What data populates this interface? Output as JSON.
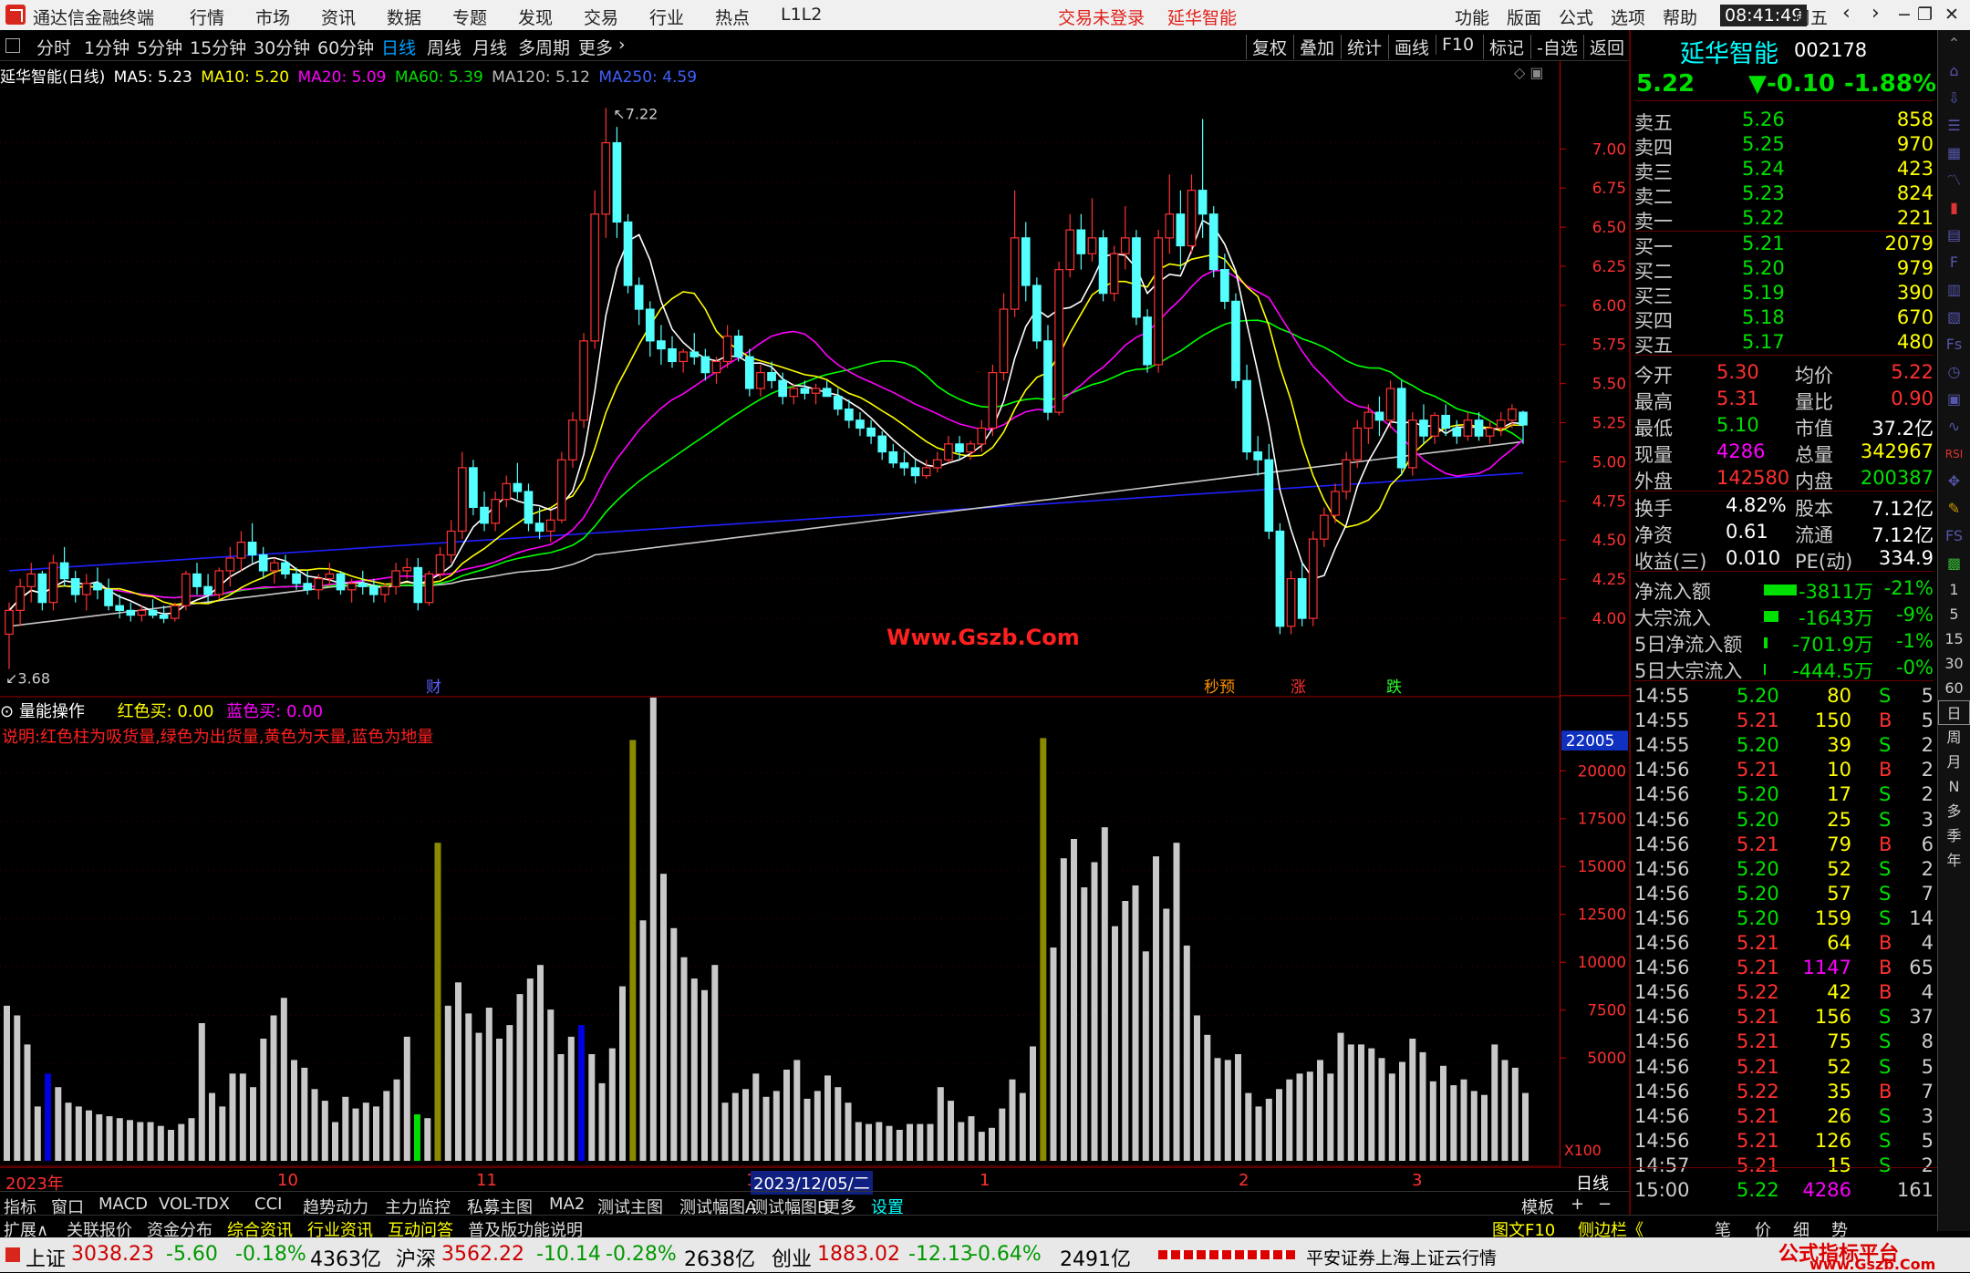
{
  "title_bar": {
    "app": "通达信金融终端",
    "menu": [
      "行情",
      "市场",
      "资讯",
      "数据",
      "专题",
      "发现",
      "交易",
      "行业",
      "热点",
      "L1L2"
    ],
    "login": "交易未登录",
    "stock": "延华智能",
    "right_menu": [
      "功能",
      "版面",
      "公式",
      "选项",
      "帮助"
    ],
    "time": "08:41:49",
    "weekday": "周五"
  },
  "toolbar": {
    "periods": [
      "分时",
      "1分钟",
      "5分钟",
      "15分钟",
      "30分钟",
      "60分钟",
      "日线",
      "周线",
      "月线",
      "多周期",
      "更多"
    ],
    "active": "日线",
    "right": [
      "复权",
      "叠加",
      "统计",
      "画线",
      "F10",
      "标记",
      "-自选",
      "返回"
    ]
  },
  "main_legend": {
    "name": "延华智能(日线)",
    "ma5": "MA5: 5.23",
    "ma10": "MA10: 5.20",
    "ma20": "MA20: 5.09",
    "ma60": "MA60: 5.39",
    "ma120": "MA120: 5.12",
    "ma250": "MA250: 4.59"
  },
  "annotations": {
    "high": "7.22",
    "low": "3.68",
    "watermark": "Www.Gszb.Com",
    "markers": [
      "财",
      "秒预",
      "涨",
      "跌"
    ]
  },
  "price_axis": [
    "7.00",
    "6.75",
    "6.50",
    "6.25",
    "6.00",
    "5.75",
    "5.50",
    "5.25",
    "5.00",
    "4.75",
    "4.50",
    "4.25",
    "4.00"
  ],
  "vol_legend": {
    "name": "量能操作",
    "red_buy": "红色买: 0.00",
    "blue_buy": "蓝色买: 0.00",
    "desc": "说明:红色柱为吸货量,绿色为出货量,黄色为天量,蓝色为地量"
  },
  "vol_axis": {
    "badge": "22005",
    "ticks": [
      "20000",
      "17500",
      "15000",
      "12500",
      "10000",
      "7500",
      "5000"
    ],
    "unit": "X100"
  },
  "date_axis": {
    "labels": [
      "2023年",
      "10",
      "11",
      "12",
      "1",
      "2",
      "3"
    ],
    "cursor": "2023/12/05/二",
    "period": "日线"
  },
  "quote": {
    "name": "延华智能",
    "code": "002178",
    "price": "5.22",
    "change": "▼-0.10",
    "pct": "-1.88%",
    "asks": [
      [
        "卖五",
        "5.26",
        "858"
      ],
      [
        "卖四",
        "5.25",
        "970"
      ],
      [
        "卖三",
        "5.24",
        "423"
      ],
      [
        "卖二",
        "5.23",
        "824"
      ],
      [
        "卖一",
        "5.22",
        "221"
      ]
    ],
    "bids": [
      [
        "买一",
        "5.21",
        "2079"
      ],
      [
        "买二",
        "5.20",
        "979"
      ],
      [
        "买三",
        "5.19",
        "390"
      ],
      [
        "买四",
        "5.18",
        "670"
      ],
      [
        "买五",
        "5.17",
        "480"
      ]
    ],
    "stats": [
      [
        "今开",
        "5.30",
        "均价",
        "5.22"
      ],
      [
        "最高",
        "5.31",
        "量比",
        "0.90"
      ],
      [
        "最低",
        "5.10",
        "市值",
        "37.2亿"
      ],
      [
        "现量",
        "4286",
        "总量",
        "342967"
      ],
      [
        "外盘",
        "142580",
        "内盘",
        "200387"
      ]
    ],
    "stats2": [
      [
        "换手",
        "4.82%",
        "股本",
        "7.12亿"
      ],
      [
        "净资",
        "0.61",
        "流通",
        "7.12亿"
      ],
      [
        "收益(三)",
        "0.010",
        "PE(动)",
        "334.9"
      ]
    ],
    "flows": [
      [
        "净流入额",
        "-3811万",
        "-21%"
      ],
      [
        "大宗流入",
        "-1643万",
        "-9%"
      ],
      [
        "5日净流入额",
        "-701.9万",
        "-1%"
      ],
      [
        "5日大宗流入",
        "-444.5万",
        "-0%"
      ]
    ],
    "ticks": [
      [
        "14:55",
        "5.20",
        "80",
        "S",
        "5"
      ],
      [
        "14:55",
        "5.21",
        "150",
        "B",
        "5"
      ],
      [
        "14:55",
        "5.20",
        "39",
        "S",
        "2"
      ],
      [
        "14:56",
        "5.21",
        "10",
        "B",
        "2"
      ],
      [
        "14:56",
        "5.20",
        "17",
        "S",
        "2"
      ],
      [
        "14:56",
        "5.20",
        "25",
        "S",
        "3"
      ],
      [
        "14:56",
        "5.21",
        "79",
        "B",
        "6"
      ],
      [
        "14:56",
        "5.20",
        "52",
        "S",
        "2"
      ],
      [
        "14:56",
        "5.20",
        "57",
        "S",
        "7"
      ],
      [
        "14:56",
        "5.20",
        "159",
        "S",
        "14"
      ],
      [
        "14:56",
        "5.21",
        "64",
        "B",
        "4"
      ],
      [
        "14:56",
        "5.21",
        "1147",
        "B",
        "65"
      ],
      [
        "14:56",
        "5.22",
        "42",
        "B",
        "4"
      ],
      [
        "14:56",
        "5.21",
        "156",
        "S",
        "37"
      ],
      [
        "14:56",
        "5.21",
        "75",
        "S",
        "8"
      ],
      [
        "14:56",
        "5.21",
        "52",
        "S",
        "5"
      ],
      [
        "14:56",
        "5.22",
        "35",
        "B",
        "7"
      ],
      [
        "14:56",
        "5.21",
        "26",
        "S",
        "3"
      ],
      [
        "14:56",
        "5.21",
        "126",
        "S",
        "5"
      ],
      [
        "14:57",
        "5.21",
        "15",
        "S",
        "2"
      ],
      [
        "15:00",
        "5.22",
        "4286",
        "",
        "161"
      ]
    ]
  },
  "sidebar": [
    "1",
    "5",
    "15",
    "30",
    "60",
    "日",
    "周",
    "月",
    "N",
    "多",
    "季",
    "年"
  ],
  "tabs1": [
    "指标",
    "窗口",
    "MACD",
    "VOL-TDX",
    "CCI",
    "趋势动力",
    "主力监控",
    "私募主图",
    "MA2",
    "测试主图",
    "测试幅图A",
    "测试幅图B",
    "更多",
    "设置"
  ],
  "tabs1_right": [
    "模板",
    "+",
    "−"
  ],
  "tabs2": [
    "扩展∧",
    "关联报价",
    "资金分布",
    "综合资讯",
    "行业资讯",
    "互动问答",
    "普及版功能说明"
  ],
  "tabs2_right": [
    "图文F10",
    "侧边栏《",
    "笔",
    "价",
    "细",
    "势"
  ],
  "status": {
    "sh": [
      "上证",
      "3038.23",
      "-5.60",
      "-0.18%",
      "4363亿"
    ],
    "sz": [
      "沪深",
      "3562.22",
      "-10.14",
      "-0.28%",
      "2638亿"
    ],
    "cy": [
      "创业",
      "1883.02",
      "-12.13",
      "-0.64%",
      "2491亿"
    ],
    "broker": "平安证券上海上证云行情",
    "brand": "公式指标平台",
    "brand_url": "www.Gszb.Com"
  },
  "chart_data": {
    "type": "candlestick",
    "candles": [
      [
        3.9,
        4.1,
        3.68,
        4.05
      ],
      [
        4.05,
        4.25,
        3.95,
        4.2
      ],
      [
        4.2,
        4.35,
        4.1,
        4.28
      ],
      [
        4.28,
        4.3,
        4.05,
        4.1
      ],
      [
        4.1,
        4.4,
        4.05,
        4.35
      ],
      [
        4.35,
        4.45,
        4.2,
        4.25
      ],
      [
        4.25,
        4.3,
        4.1,
        4.15
      ],
      [
        4.15,
        4.28,
        4.05,
        4.22
      ],
      [
        4.22,
        4.32,
        4.12,
        4.18
      ],
      [
        4.18,
        4.25,
        4.05,
        4.08
      ],
      [
        4.08,
        4.15,
        4.0,
        4.05
      ],
      [
        4.05,
        4.1,
        3.98,
        4.02
      ],
      [
        4.02,
        4.08,
        3.98,
        4.05
      ],
      [
        4.05,
        4.12,
        4.0,
        4.02
      ],
      [
        4.02,
        4.08,
        3.97,
        4.0
      ],
      [
        4.0,
        4.1,
        3.98,
        4.08
      ],
      [
        4.08,
        4.3,
        4.05,
        4.28
      ],
      [
        4.28,
        4.35,
        4.15,
        4.2
      ],
      [
        4.2,
        4.28,
        4.1,
        4.15
      ],
      [
        4.15,
        4.32,
        4.12,
        4.3
      ],
      [
        4.3,
        4.45,
        4.2,
        4.38
      ],
      [
        4.38,
        4.55,
        4.3,
        4.48
      ],
      [
        4.48,
        4.6,
        4.35,
        4.4
      ],
      [
        4.4,
        4.45,
        4.25,
        4.3
      ],
      [
        4.3,
        4.38,
        4.22,
        4.35
      ],
      [
        4.35,
        4.4,
        4.25,
        4.28
      ],
      [
        4.28,
        4.32,
        4.18,
        4.22
      ],
      [
        4.22,
        4.3,
        4.15,
        4.18
      ],
      [
        4.18,
        4.28,
        4.12,
        4.25
      ],
      [
        4.25,
        4.35,
        4.2,
        4.28
      ],
      [
        4.28,
        4.3,
        4.15,
        4.18
      ],
      [
        4.18,
        4.25,
        4.1,
        4.22
      ],
      [
        4.22,
        4.3,
        4.15,
        4.2
      ],
      [
        4.2,
        4.25,
        4.1,
        4.15
      ],
      [
        4.15,
        4.22,
        4.1,
        4.2
      ],
      [
        4.2,
        4.35,
        4.15,
        4.3
      ],
      [
        4.3,
        4.38,
        4.25,
        4.32
      ],
      [
        4.32,
        4.38,
        4.05,
        4.1
      ],
      [
        4.1,
        4.3,
        4.08,
        4.28
      ],
      [
        4.28,
        4.45,
        4.25,
        4.4
      ],
      [
        4.4,
        4.62,
        4.35,
        4.55
      ],
      [
        4.55,
        5.05,
        4.5,
        4.95
      ],
      [
        4.95,
        5.0,
        4.65,
        4.7
      ],
      [
        4.7,
        4.8,
        4.55,
        4.6
      ],
      [
        4.6,
        4.8,
        4.55,
        4.75
      ],
      [
        4.75,
        4.9,
        4.7,
        4.85
      ],
      [
        4.85,
        4.98,
        4.75,
        4.8
      ],
      [
        4.8,
        4.85,
        4.55,
        4.6
      ],
      [
        4.6,
        4.7,
        4.5,
        4.55
      ],
      [
        4.55,
        4.68,
        4.48,
        4.62
      ],
      [
        4.62,
        5.05,
        4.6,
        5.0
      ],
      [
        5.0,
        5.3,
        4.95,
        5.25
      ],
      [
        5.25,
        5.8,
        5.2,
        5.75
      ],
      [
        5.75,
        6.7,
        5.7,
        6.55
      ],
      [
        6.55,
        7.22,
        6.4,
        7.0
      ],
      [
        7.0,
        7.1,
        6.4,
        6.5
      ],
      [
        6.5,
        6.55,
        6.05,
        6.1
      ],
      [
        6.1,
        6.15,
        5.85,
        5.95
      ],
      [
        5.95,
        6.0,
        5.65,
        5.75
      ],
      [
        5.75,
        5.85,
        5.6,
        5.7
      ],
      [
        5.7,
        5.78,
        5.58,
        5.62
      ],
      [
        5.62,
        5.7,
        5.55,
        5.68
      ],
      [
        5.68,
        5.8,
        5.6,
        5.65
      ],
      [
        5.65,
        5.7,
        5.5,
        5.55
      ],
      [
        5.55,
        5.65,
        5.48,
        5.62
      ],
      [
        5.62,
        5.85,
        5.58,
        5.78
      ],
      [
        5.78,
        5.82,
        5.62,
        5.65
      ],
      [
        5.65,
        5.7,
        5.4,
        5.45
      ],
      [
        5.45,
        5.6,
        5.4,
        5.55
      ],
      [
        5.55,
        5.62,
        5.45,
        5.5
      ],
      [
        5.5,
        5.55,
        5.35,
        5.4
      ],
      [
        5.4,
        5.48,
        5.35,
        5.45
      ],
      [
        5.45,
        5.5,
        5.38,
        5.42
      ],
      [
        5.42,
        5.48,
        5.35,
        5.45
      ],
      [
        5.45,
        5.5,
        5.4,
        5.4
      ],
      [
        5.4,
        5.45,
        5.28,
        5.32
      ],
      [
        5.32,
        5.38,
        5.2,
        5.25
      ],
      [
        5.25,
        5.3,
        5.15,
        5.2
      ],
      [
        5.2,
        5.25,
        5.1,
        5.15
      ],
      [
        5.15,
        5.18,
        5.0,
        5.05
      ],
      [
        5.05,
        5.1,
        4.95,
        4.98
      ],
      [
        4.98,
        5.05,
        4.9,
        4.95
      ],
      [
        4.95,
        5.0,
        4.85,
        4.9
      ],
      [
        4.9,
        5.0,
        4.88,
        4.95
      ],
      [
        4.95,
        5.05,
        4.92,
        5.0
      ],
      [
        5.0,
        5.15,
        4.98,
        5.1
      ],
      [
        5.1,
        5.15,
        5.0,
        5.05
      ],
      [
        5.05,
        5.12,
        5.0,
        5.1
      ],
      [
        5.1,
        5.25,
        5.05,
        5.2
      ],
      [
        5.2,
        5.6,
        5.15,
        5.55
      ],
      [
        5.55,
        6.05,
        5.5,
        5.95
      ],
      [
        5.95,
        6.7,
        5.9,
        6.4
      ],
      [
        6.4,
        6.5,
        6.0,
        6.1
      ],
      [
        6.1,
        6.15,
        5.7,
        5.75
      ],
      [
        5.75,
        5.85,
        5.25,
        5.3
      ],
      [
        5.3,
        6.25,
        5.28,
        6.2
      ],
      [
        6.2,
        6.55,
        6.15,
        6.45
      ],
      [
        6.45,
        6.55,
        6.2,
        6.3
      ],
      [
        6.3,
        6.65,
        6.25,
        6.4
      ],
      [
        6.4,
        6.45,
        6.0,
        6.05
      ],
      [
        6.05,
        6.35,
        6.0,
        6.3
      ],
      [
        6.3,
        6.6,
        6.2,
        6.4
      ],
      [
        6.4,
        6.45,
        5.85,
        5.9
      ],
      [
        5.9,
        5.95,
        5.55,
        5.6
      ],
      [
        5.6,
        6.45,
        5.55,
        6.4
      ],
      [
        6.4,
        6.8,
        6.3,
        6.55
      ],
      [
        6.55,
        6.7,
        6.2,
        6.35
      ],
      [
        6.35,
        6.8,
        6.3,
        6.7
      ],
      [
        6.7,
        7.15,
        6.4,
        6.55
      ],
      [
        6.55,
        6.6,
        6.15,
        6.2
      ],
      [
        6.2,
        6.3,
        5.95,
        6.0
      ],
      [
        6.0,
        6.05,
        5.45,
        5.5
      ],
      [
        5.5,
        5.6,
        5.0,
        5.05
      ],
      [
        5.05,
        5.15,
        4.9,
        5.0
      ],
      [
        5.0,
        5.1,
        4.5,
        4.55
      ],
      [
        4.55,
        4.6,
        3.9,
        3.95
      ],
      [
        3.95,
        4.3,
        3.9,
        4.25
      ],
      [
        4.25,
        4.35,
        3.95,
        4.0
      ],
      [
        4.0,
        4.55,
        3.95,
        4.5
      ],
      [
        4.5,
        4.7,
        4.45,
        4.65
      ],
      [
        4.65,
        4.85,
        4.6,
        4.8
      ],
      [
        4.8,
        5.05,
        4.75,
        5.0
      ],
      [
        5.0,
        5.25,
        4.95,
        5.2
      ],
      [
        5.2,
        5.35,
        5.1,
        5.3
      ],
      [
        5.3,
        5.4,
        5.15,
        5.25
      ],
      [
        5.25,
        5.5,
        5.2,
        5.45
      ],
      [
        5.45,
        5.5,
        4.9,
        4.95
      ],
      [
        4.95,
        5.3,
        4.9,
        5.25
      ],
      [
        5.25,
        5.35,
        5.1,
        5.15
      ],
      [
        5.15,
        5.3,
        5.1,
        5.28
      ],
      [
        5.28,
        5.35,
        5.15,
        5.2
      ],
      [
        5.2,
        5.25,
        5.1,
        5.15
      ],
      [
        5.15,
        5.3,
        5.12,
        5.25
      ],
      [
        5.25,
        5.3,
        5.12,
        5.15
      ],
      [
        5.15,
        5.25,
        5.1,
        5.2
      ],
      [
        5.2,
        5.3,
        5.15,
        5.25
      ],
      [
        5.25,
        5.35,
        5.2,
        5.32
      ],
      [
        5.3,
        5.31,
        5.1,
        5.22
      ]
    ],
    "volume": [
      8000,
      7500,
      6000,
      2800,
      4500,
      3800,
      3000,
      2800,
      2600,
      2400,
      2300,
      2200,
      2100,
      2000,
      2000,
      1800,
      1600,
      1900,
      2200,
      7100,
      3500,
      2800,
      4500,
      4500,
      3800,
      6300,
      7500,
      8400,
      5200,
      4800,
      3700,
      3100,
      2000,
      3300,
      2700,
      3000,
      2800,
      3600,
      4200,
      6400,
      2400,
      2200,
      16400,
      8000,
      9200,
      7600,
      6600,
      7900,
      6300,
      7000,
      8600,
      9400,
      10100,
      7800,
      5500,
      6400,
      7000,
      5500,
      4000,
      5800,
      9000,
      21700,
      12400,
      24500,
      14800,
      12000,
      10500,
      9400,
      8800,
      10100,
      3000,
      3500,
      3700,
      4500,
      3300,
      3600,
      4700,
      5200,
      3200,
      3600,
      4400,
      3800,
      3000,
      2000,
      1900,
      2000,
      1800,
      1600,
      1900,
      1900,
      1900,
      3800,
      3100,
      2000,
      2300,
      1500,
      1700,
      2700,
      4200,
      3500,
      5900,
      21800,
      11000,
      15600,
      16600,
      14100,
      15400,
      17200,
      12100,
      13400,
      14200,
      10800,
      15700,
      13000,
      16400,
      11100,
      7500,
      6500,
      5300,
      5200,
      5500,
      3500,
      2800,
      3200,
      3700,
      4200,
      4500,
      4600,
      5200,
      4500,
      6600,
      6000,
      6000,
      5800,
      5300,
      4500,
      5100,
      6300,
      5600,
      4100,
      4900,
      3900,
      4200,
      3600,
      3400,
      6000,
      5200,
      4800,
      3500
    ],
    "vol_colors": {
      "yellow": [
        42,
        61,
        101
      ],
      "green": [
        40
      ],
      "blue": [
        4,
        56
      ]
    },
    "ma_colors": {
      "ma5": "#ffffff",
      "ma10": "#ffff00",
      "ma20": "#ff00ff",
      "ma60": "#00ff00",
      "ma120": "#c8c8c8",
      "ma250": "#2020ff"
    },
    "ylim": [
      3.5,
      7.4
    ],
    "vol_max": 22005
  }
}
